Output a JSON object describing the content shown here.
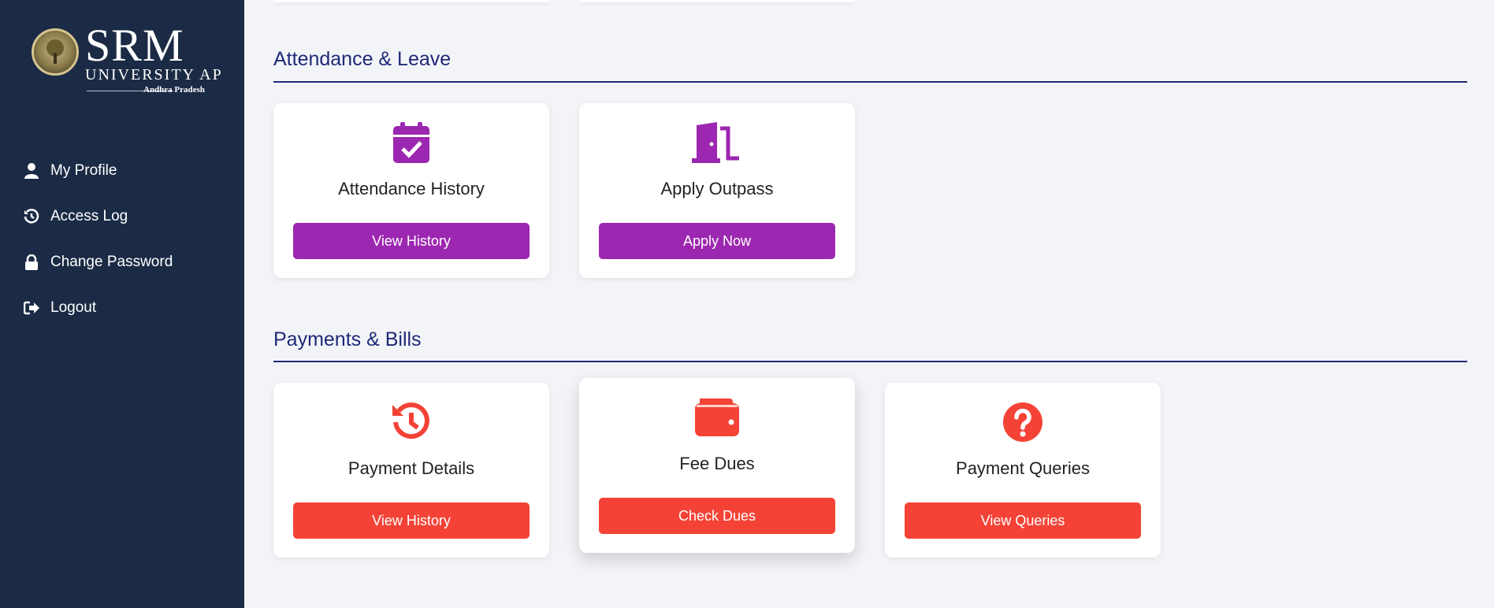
{
  "sidebar": {
    "logo": {
      "name": "SRM",
      "line2": "UNIVERSITY AP",
      "line3": "Andhra Pradesh"
    },
    "items": [
      {
        "label": "My Profile",
        "icon": "user-icon"
      },
      {
        "label": "Access Log",
        "icon": "history-icon"
      },
      {
        "label": "Change Password",
        "icon": "lock-icon"
      },
      {
        "label": "Logout",
        "icon": "logout-icon"
      }
    ]
  },
  "sections": {
    "attendance": {
      "title": "Attendance & Leave",
      "cards": [
        {
          "title": "Attendance History",
          "button": "View History",
          "icon": "calendar-check-icon"
        },
        {
          "title": "Apply Outpass",
          "button": "Apply Now",
          "icon": "door-open-icon"
        }
      ]
    },
    "payments": {
      "title": "Payments & Bills",
      "cards": [
        {
          "title": "Payment Details",
          "button": "View History",
          "icon": "clock-history-icon"
        },
        {
          "title": "Fee Dues",
          "button": "Check Dues",
          "icon": "wallet-icon"
        },
        {
          "title": "Payment Queries",
          "button": "View Queries",
          "icon": "question-circle-icon"
        }
      ]
    }
  },
  "colors": {
    "sidebar": "#1b2b45",
    "heading": "#1e2a78",
    "purple": "#9c27b0",
    "red": "#f44336",
    "background": "#f3f4f8"
  }
}
